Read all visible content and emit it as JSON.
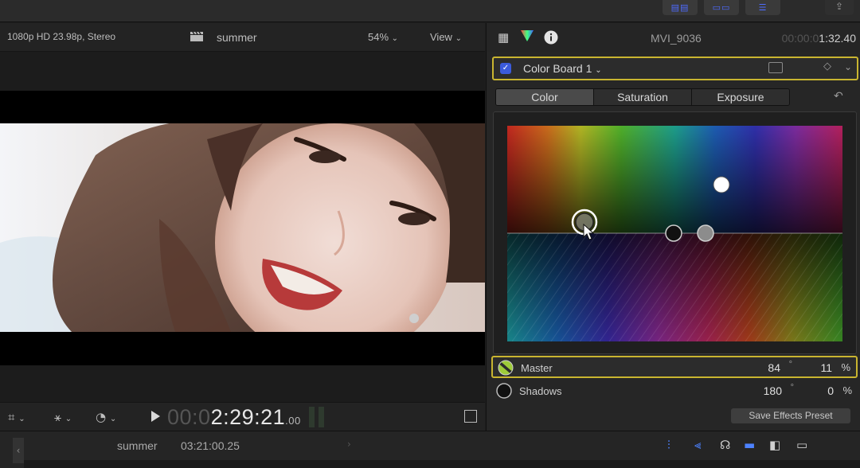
{
  "topbar": {
    "icons": [
      "library-panel-icon",
      "browser-panel-icon",
      "inspector-panel-icon"
    ],
    "share_icon": "share-icon"
  },
  "viewer": {
    "format": "1080p HD 23.98p, Stereo",
    "project": "summer",
    "zoom": "54%",
    "view_label": "View",
    "timecode_dim": "00:0",
    "timecode_main": "2:29:21",
    "timecode_frames": ".00"
  },
  "inspector": {
    "clip_name": "MVI_9036",
    "duration_dim": "00:00:0",
    "duration_main": "1:32.40",
    "effect_name": "Color Board 1",
    "effect_enabled": true,
    "tabs": [
      {
        "label": "Color",
        "active": true
      },
      {
        "label": "Saturation",
        "active": false
      },
      {
        "label": "Exposure",
        "active": false
      }
    ],
    "params": {
      "master": {
        "label": "Master",
        "angle": "84",
        "deg": "°",
        "percent": "11",
        "pct_sym": "%"
      },
      "shadows": {
        "label": "Shadows",
        "angle": "180",
        "deg": "°",
        "percent": "0",
        "pct_sym": "%"
      }
    },
    "save_preset_label": "Save Effects Preset",
    "colors": {
      "highlight": "#c9b530",
      "accent": "#3b5bdb",
      "master_puck": "#9ecb3a"
    }
  },
  "timeline": {
    "project": "summer",
    "duration": "03:21:00.25"
  }
}
